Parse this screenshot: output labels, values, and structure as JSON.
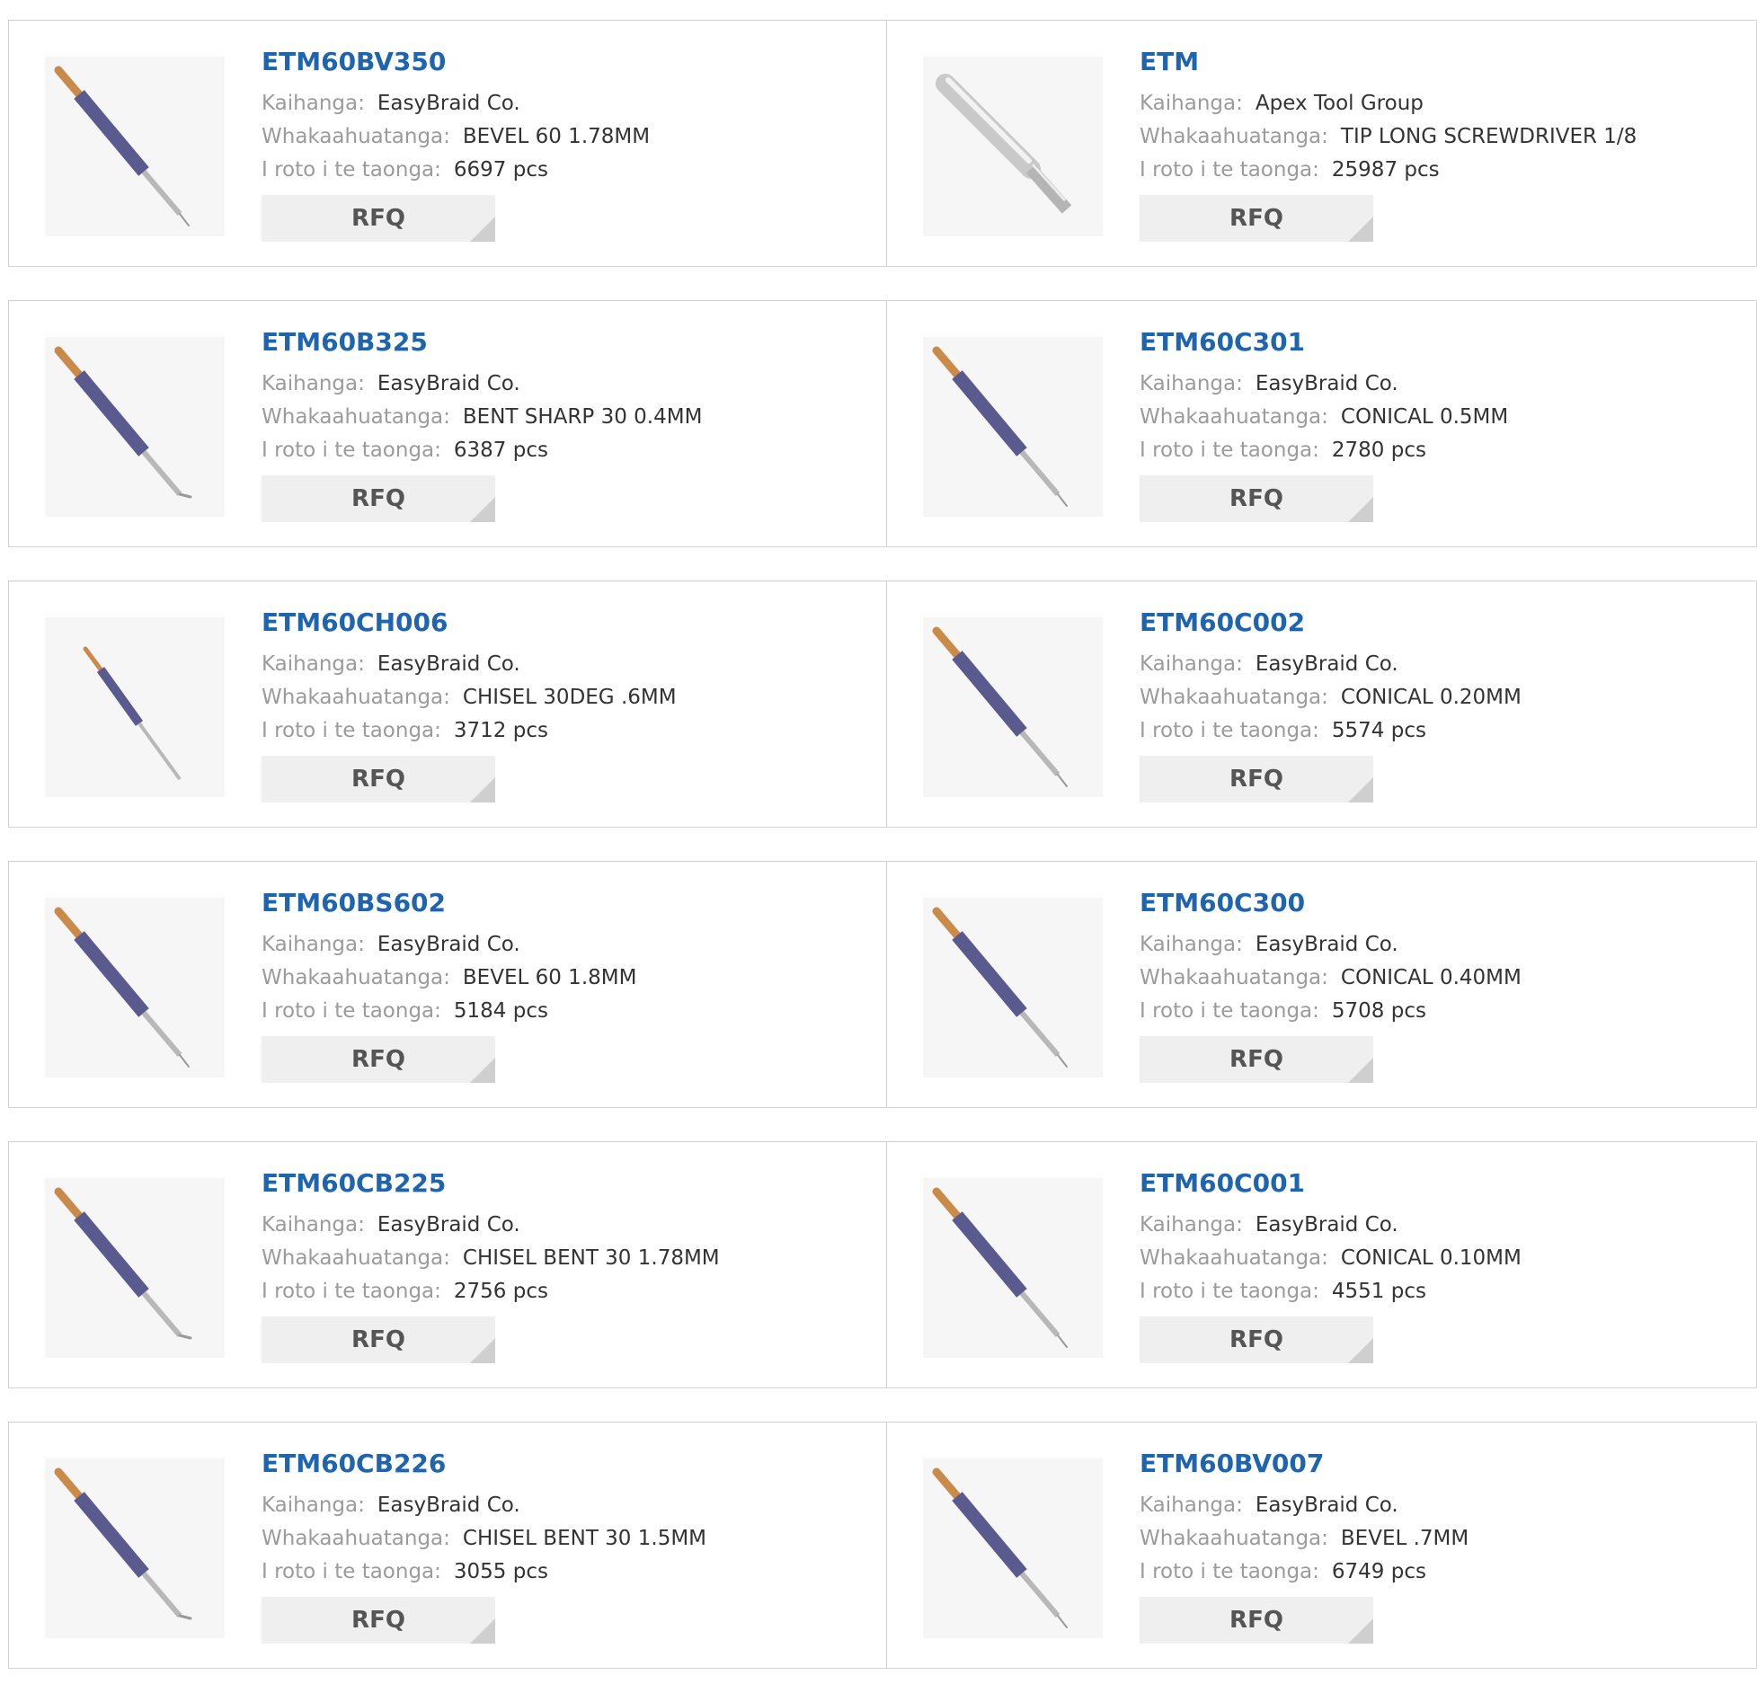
{
  "labels": {
    "manufacturer": "Kaihanga:",
    "description": "Whakaahuatanga:",
    "stock": "I roto i te taonga:",
    "rfq": "RFQ"
  },
  "products": [
    {
      "part": "ETM60BV350",
      "manufacturer": "EasyBraid Co.",
      "description": "BEVEL 60 1.78MM",
      "stock": "6697 pcs",
      "image": "soldering-tip-bevel-icon"
    },
    {
      "part": "ETM",
      "manufacturer": "Apex Tool Group",
      "description": "TIP LONG SCREWDRIVER 1/8",
      "stock": "25987 pcs",
      "image": "screwdriver-tip-icon"
    },
    {
      "part": "ETM60B325",
      "manufacturer": "EasyBraid Co.",
      "description": "BENT SHARP 30 0.4MM",
      "stock": "6387 pcs",
      "image": "soldering-tip-bent-icon"
    },
    {
      "part": "ETM60C301",
      "manufacturer": "EasyBraid Co.",
      "description": "CONICAL 0.5MM",
      "stock": "2780 pcs",
      "image": "soldering-tip-conical-icon"
    },
    {
      "part": "ETM60CH006",
      "manufacturer": "EasyBraid Co.",
      "description": "CHISEL 30DEG .6MM",
      "stock": "3712 pcs",
      "image": "soldering-tip-chisel-icon"
    },
    {
      "part": "ETM60C002",
      "manufacturer": "EasyBraid Co.",
      "description": "CONICAL 0.20MM",
      "stock": "5574 pcs",
      "image": "soldering-tip-conical-icon"
    },
    {
      "part": "ETM60BS602",
      "manufacturer": "EasyBraid Co.",
      "description": "BEVEL 60 1.8MM",
      "stock": "5184 pcs",
      "image": "soldering-tip-bevel-icon"
    },
    {
      "part": "ETM60C300",
      "manufacturer": "EasyBraid Co.",
      "description": "CONICAL 0.40MM",
      "stock": "5708 pcs",
      "image": "soldering-tip-conical-icon"
    },
    {
      "part": "ETM60CB225",
      "manufacturer": "EasyBraid Co.",
      "description": "CHISEL BENT 30 1.78MM",
      "stock": "2756 pcs",
      "image": "soldering-tip-bent-icon"
    },
    {
      "part": "ETM60C001",
      "manufacturer": "EasyBraid Co.",
      "description": "CONICAL 0.10MM",
      "stock": "4551 pcs",
      "image": "soldering-tip-conical-icon"
    },
    {
      "part": "ETM60CB226",
      "manufacturer": "EasyBraid Co.",
      "description": "CHISEL BENT 30 1.5MM",
      "stock": "3055 pcs",
      "image": "soldering-tip-bent-icon"
    },
    {
      "part": "ETM60BV007",
      "manufacturer": "EasyBraid Co.",
      "description": "BEVEL .7MM",
      "stock": "6749 pcs",
      "image": "soldering-tip-bevel-icon"
    }
  ],
  "colors": {
    "title": "#1e64ae",
    "label": "#9b9b9b",
    "value": "#333333",
    "button_bg": "#efefef",
    "button_text": "#555555",
    "border": "#d3d3d3",
    "tip_handle": "#5b5a8e",
    "tip_copper": "#c98a4a",
    "tip_steel": "#b8b8b8"
  }
}
